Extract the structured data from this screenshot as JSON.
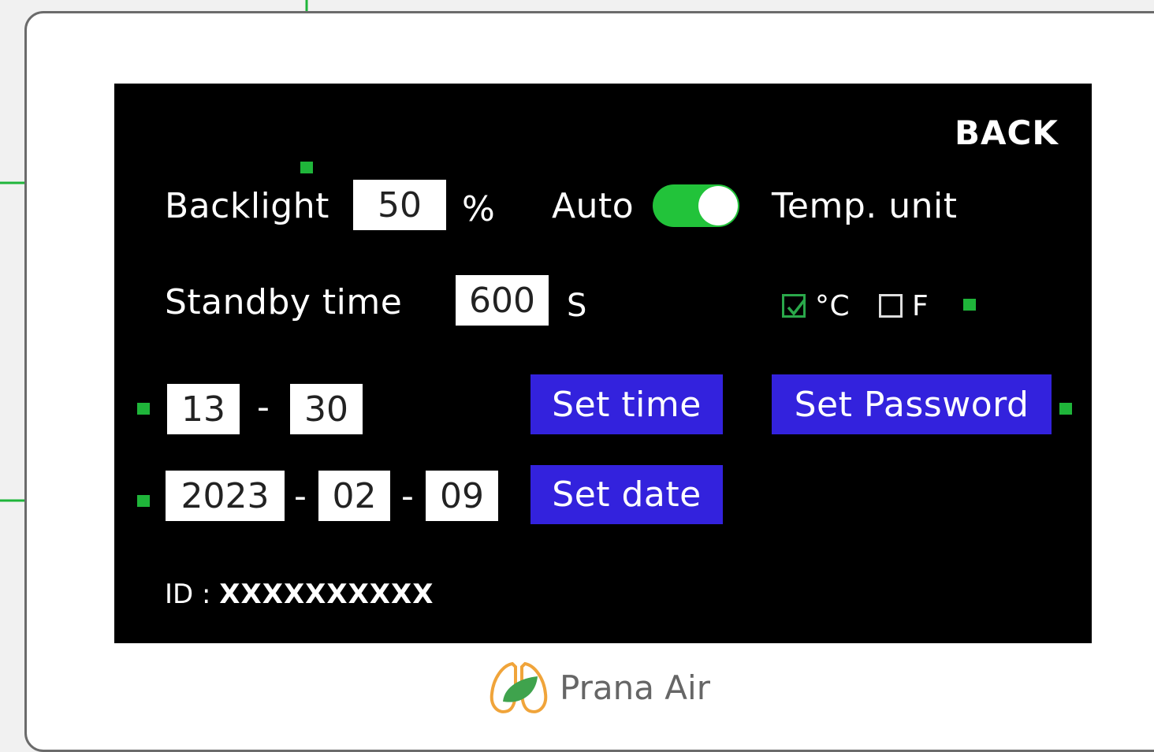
{
  "screen": {
    "back_label": "BACK",
    "backlight": {
      "label": "Backlight",
      "value": "50",
      "unit": "%"
    },
    "auto": {
      "label": "Auto",
      "enabled": true
    },
    "temp_unit": {
      "label": "Temp. unit",
      "options": [
        {
          "label": "°C",
          "checked": true
        },
        {
          "label": "F",
          "checked": false
        }
      ]
    },
    "standby": {
      "label": "Standby time",
      "value": "600",
      "unit": "S"
    },
    "time": {
      "hour": "13",
      "separator": "-",
      "minute": "30",
      "button": "Set time"
    },
    "date": {
      "year": "2023",
      "separator": "-",
      "month": "02",
      "day": "09",
      "button": "Set date"
    },
    "password_button": "Set Password",
    "id": {
      "label": "ID :",
      "value": "XXXXXXXXXX"
    }
  },
  "brand": {
    "name": "Prana Air"
  },
  "colors": {
    "screen_bg": "#000000",
    "button_blue": "#3322dd",
    "toggle_green": "#22c33a",
    "connector_green": "#1fb53a"
  }
}
